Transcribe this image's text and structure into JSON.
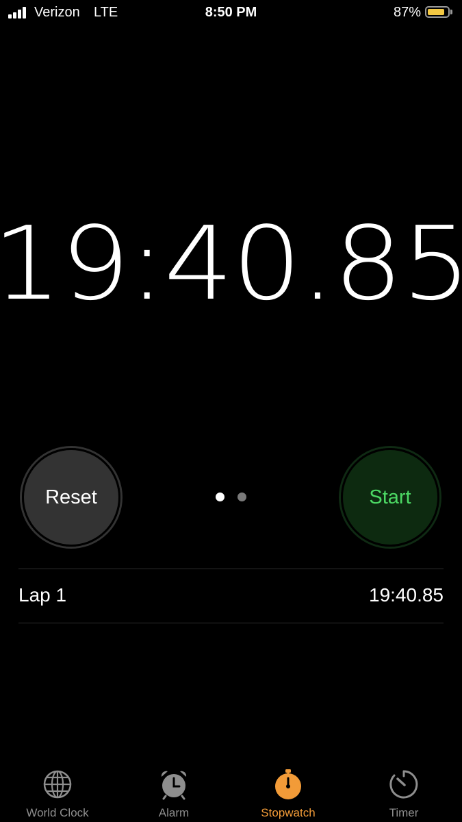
{
  "status_bar": {
    "carrier": "Verizon",
    "network": "LTE",
    "time": "8:50 PM",
    "battery_percent": "87%",
    "battery_level": 0.87,
    "signal_bars": 4,
    "battery_color": "#f3c843"
  },
  "stopwatch": {
    "elapsed": "19:40.85"
  },
  "controls": {
    "reset_label": "Reset",
    "start_label": "Start",
    "page_count": 2,
    "active_page": 1
  },
  "laps": [
    {
      "label": "Lap 1",
      "time": "19:40.85"
    }
  ],
  "tabs": [
    {
      "label": "World Clock",
      "icon": "globe-icon",
      "active": false
    },
    {
      "label": "Alarm",
      "icon": "alarm-clock-icon",
      "active": false
    },
    {
      "label": "Stopwatch",
      "icon": "stopwatch-icon",
      "active": true
    },
    {
      "label": "Timer",
      "icon": "timer-icon",
      "active": false
    }
  ],
  "colors": {
    "accent": "#f29b38",
    "start_green": "#4cd964",
    "inactive_tab": "#8e8e8e"
  }
}
